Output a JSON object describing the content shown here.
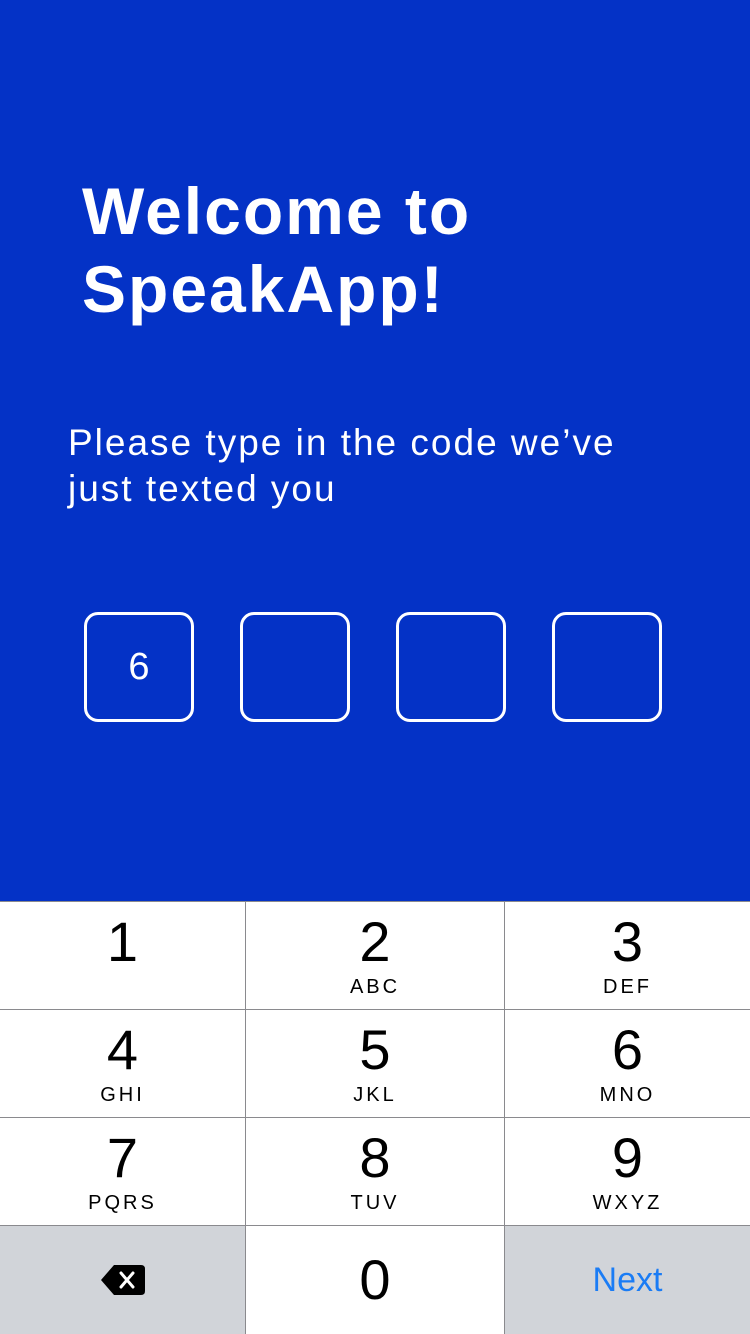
{
  "welcome": {
    "title_line1": "Welcome to",
    "title_line2": "SpeakApp!"
  },
  "instructions": {
    "line1": "Please type in the code we’ve",
    "line2": "just texted you"
  },
  "code": {
    "digits": [
      "6",
      "",
      "",
      ""
    ]
  },
  "keypad": {
    "keys": [
      {
        "digit": "1",
        "letters": ""
      },
      {
        "digit": "2",
        "letters": "ABC"
      },
      {
        "digit": "3",
        "letters": "DEF"
      },
      {
        "digit": "4",
        "letters": "GHI"
      },
      {
        "digit": "5",
        "letters": "JKL"
      },
      {
        "digit": "6",
        "letters": "MNO"
      },
      {
        "digit": "7",
        "letters": "PQRS"
      },
      {
        "digit": "8",
        "letters": "TUV"
      },
      {
        "digit": "9",
        "letters": "WXYZ"
      }
    ],
    "zero": "0",
    "next_label": "Next",
    "delete_icon": "backspace-icon"
  },
  "colors": {
    "background": "#0432c6",
    "accent": "#1a7cf5",
    "function_key": "#d1d4d9"
  }
}
